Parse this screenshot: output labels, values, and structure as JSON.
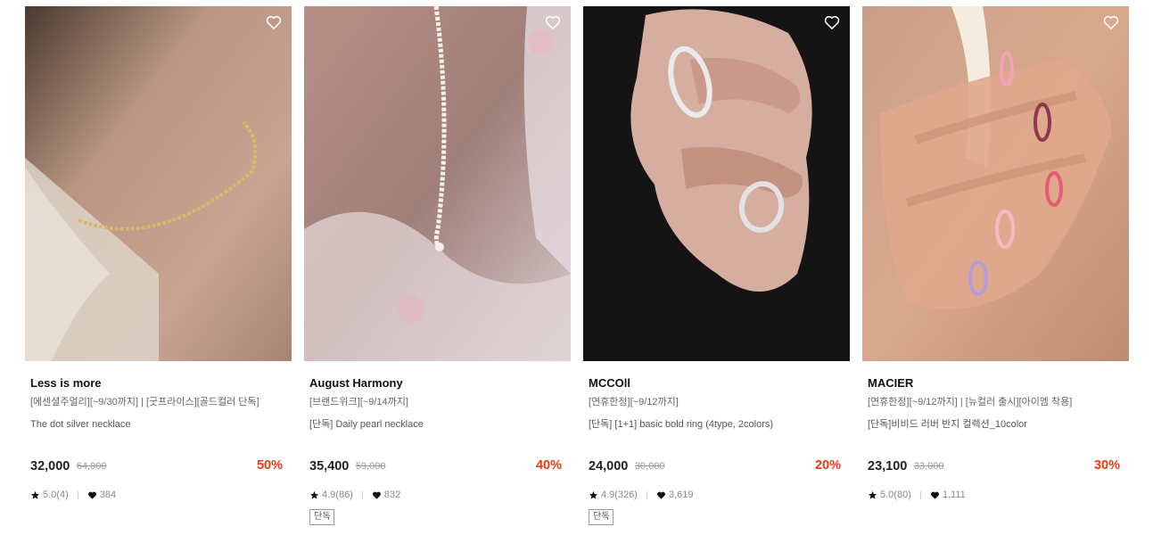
{
  "products": [
    {
      "brand": "Less is more",
      "promo": "[에센셜주얼리][~9/30까지] | [굿프라이스][골드컬러 단독]",
      "name": "The dot silver necklace",
      "price": "32,000",
      "original_price": "64,000",
      "discount": "50%",
      "rating": "5.0(4)",
      "likes": "384",
      "badge": ""
    },
    {
      "brand": "August Harmony",
      "promo": "[브랜드위크][~9/14까지]",
      "name": "[단독] Daily pearl necklace",
      "price": "35,400",
      "original_price": "59,000",
      "discount": "40%",
      "rating": "4.9(86)",
      "likes": "832",
      "badge": "단독"
    },
    {
      "brand": "MCCOll",
      "promo": "[연휴한정][~9/12까지]",
      "name": "[단독] [1+1] basic bold ring (4type, 2colors)",
      "price": "24,000",
      "original_price": "30,000",
      "discount": "20%",
      "rating": "4.9(326)",
      "likes": "3,619",
      "badge": "단독"
    },
    {
      "brand": "MACIER",
      "promo": "[연휴한정][~9/12까지] | [뉴컬러 출시][아이엠 착용]",
      "name": "[단독]비비드 러버 반지 컬렉션_10color",
      "price": "23,100",
      "original_price": "33,000",
      "discount": "30%",
      "rating": "5.0(80)",
      "likes": "1,111",
      "badge": ""
    }
  ],
  "icons": {
    "wishlist": "heart-outline-icon",
    "rating": "star-icon",
    "likes": "heart-filled-icon"
  },
  "colors": {
    "discount": "#ee3a14",
    "price": "#222222",
    "muted": "#888888"
  }
}
